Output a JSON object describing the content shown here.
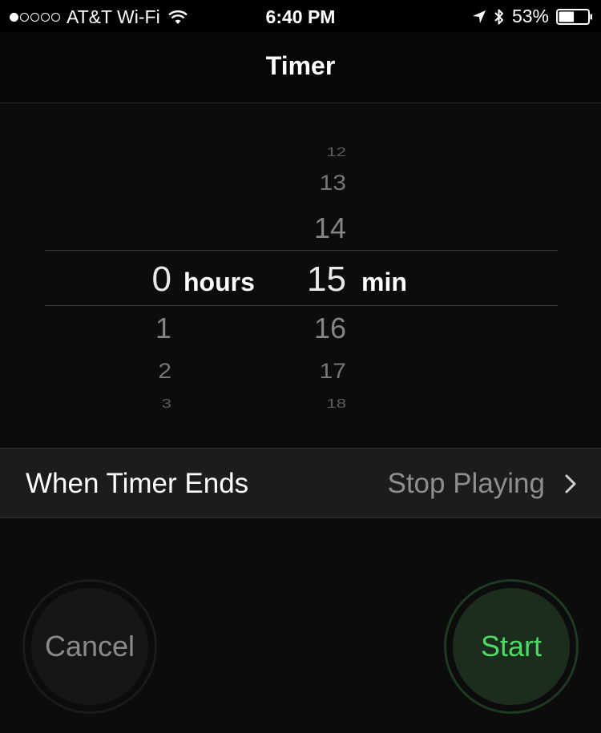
{
  "status_bar": {
    "carrier": "AT&T Wi-Fi",
    "signal_dots": [
      true,
      false,
      false,
      false,
      false
    ],
    "time": "6:40 PM",
    "battery_percent": "53%",
    "battery_level": 0.53
  },
  "nav": {
    "title": "Timer"
  },
  "picker": {
    "hours": {
      "above": [
        "",
        ""
      ],
      "selected": "0",
      "below": [
        "1",
        "2",
        "3"
      ],
      "unit": "hours"
    },
    "minutes": {
      "above": [
        "12",
        "13",
        "14"
      ],
      "selected": "15",
      "below": [
        "16",
        "17",
        "18"
      ],
      "unit": "min"
    }
  },
  "when_timer_ends": {
    "label": "When Timer Ends",
    "value": "Stop Playing"
  },
  "buttons": {
    "cancel": "Cancel",
    "start": "Start"
  },
  "colors": {
    "background": "#000000",
    "start_text": "#4cd964",
    "start_bg": "#1b2e1e",
    "cancel_text": "#8a8a8a"
  }
}
